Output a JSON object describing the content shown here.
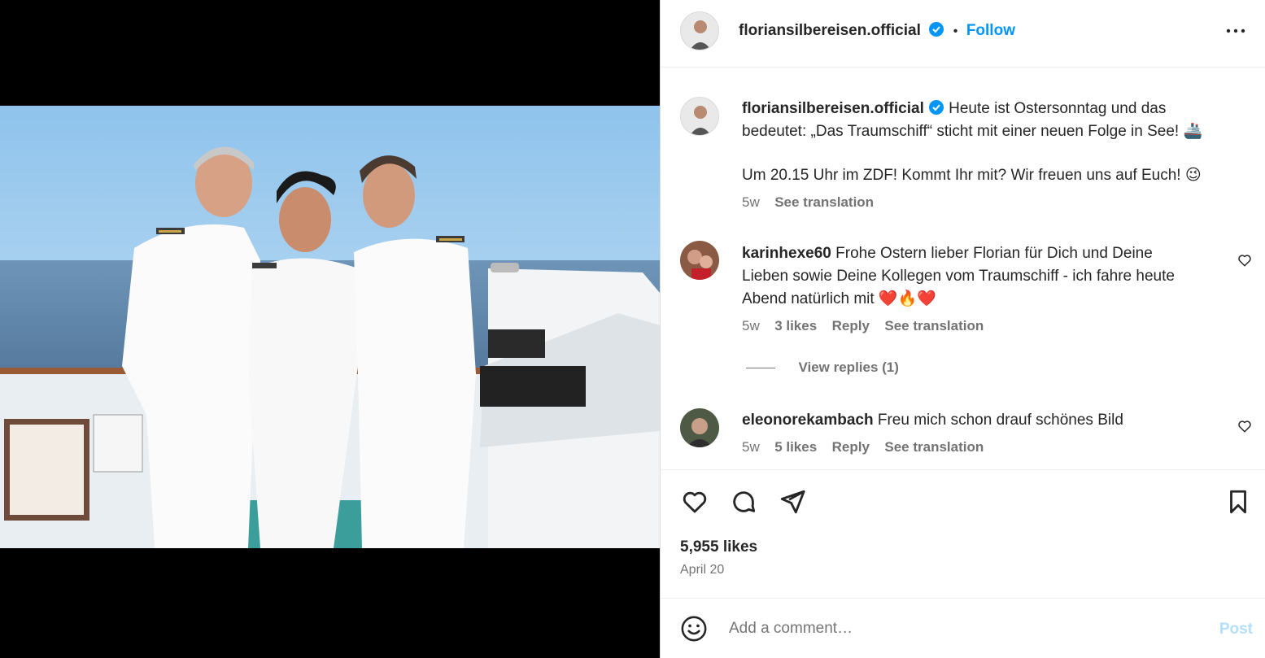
{
  "post": {
    "photo_alt": "",
    "header": {
      "username": "floriansilbereisen.official",
      "dot": "•",
      "follow_label": "Follow",
      "more_icon": "more-icon"
    },
    "caption": {
      "username": "floriansilbereisen.official",
      "line1": "Heute ist Ostersonntag und das",
      "line2": "bedeutet: „Das Traumschiff“ sticht mit einer neuen Folge in See! 🚢",
      "line3": "Um 20.15 Uhr im ZDF! Kommt Ihr mit? Wir freuen uns auf Euch! 😉",
      "time": "5w",
      "see_translation": "See translation"
    },
    "comments": [
      {
        "username": "karinhexe60",
        "line1": "Frohe Ostern lieber Florian für Dich und Deine",
        "line2": "Lieben sowie Deine Kollegen vom Traumschiff - ich fahre heute",
        "line3": "Abend natürlich mit ❤️🔥❤️",
        "time": "5w",
        "likes": "3 likes",
        "reply": "Reply",
        "see_translation": "See translation",
        "view_replies": "View replies (1)"
      },
      {
        "username": "eleonorekambach",
        "text": "Freu mich schon drauf schönes Bild",
        "time": "5w",
        "likes": "5 likes",
        "reply": "Reply",
        "see_translation": "See translation"
      }
    ],
    "likes_count": "5,955 likes",
    "date": "April 20",
    "comment_placeholder": "Add a comment…",
    "post_button": "Post"
  },
  "colors": {
    "accent": "#0095f6",
    "verified": "#0095f6",
    "muted_text": "#737373",
    "post_disabled": "#b3dffc"
  }
}
